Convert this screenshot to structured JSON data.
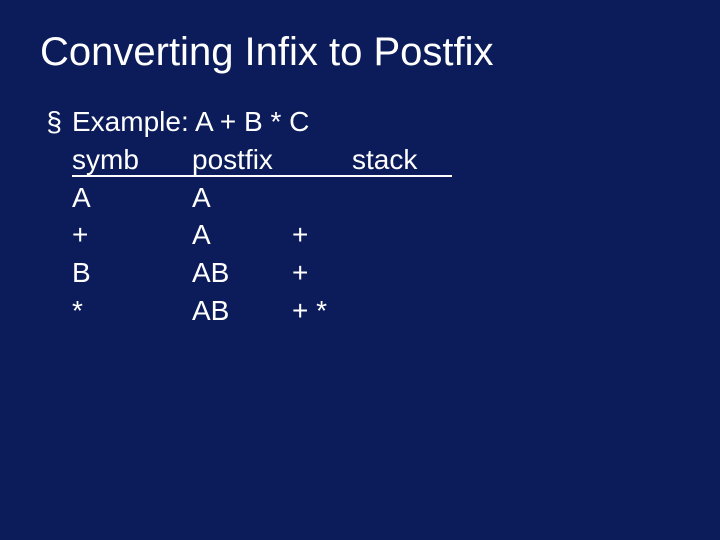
{
  "title": "Converting Infix to Postfix",
  "bullet": "§",
  "example_label": "Example: A + B * C",
  "headers": {
    "symb": "symb",
    "postfix": "postfix",
    "stack": "stack"
  },
  "rows": [
    {
      "symb": "A",
      "postfix": "A",
      "stack": ""
    },
    {
      "symb": "+",
      "postfix": "A",
      "stack": "+"
    },
    {
      "symb": "B",
      "postfix": "AB",
      "stack": "+"
    },
    {
      "symb": "*",
      "postfix": "AB",
      "stack": "+ *"
    }
  ]
}
